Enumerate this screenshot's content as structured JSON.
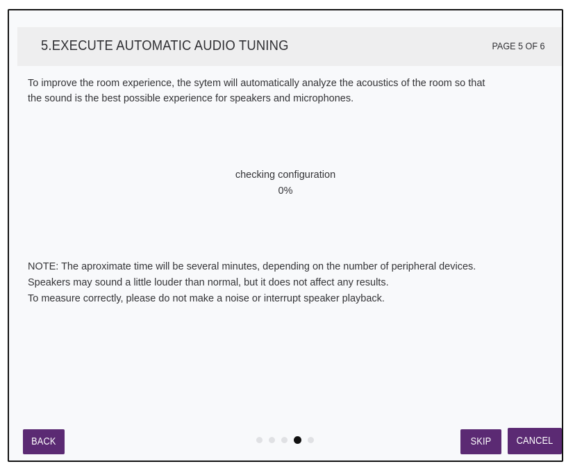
{
  "header": {
    "title": "5.EXECUTE AUTOMATIC AUDIO TUNING",
    "page_indicator": "PAGE 5 OF 6"
  },
  "description": {
    "line1": "To improve the room experience, the sytem will automatically analyze the acoustics of the room so that",
    "line2": "the sound is the best possible experience for speakers and microphones."
  },
  "status": {
    "label": "checking configuration",
    "progress_text": "0%",
    "progress_value": 0
  },
  "note": {
    "line1": "NOTE: The aproximate time will be several minutes, depending on the number of peripheral devices.",
    "line2": "Speakers may sound a little louder than normal, but it does not affect any results.",
    "line3": "To measure correctly, please do not make a noise or interrupt speaker playback."
  },
  "buttons": {
    "back": "BACK",
    "skip": "SKIP",
    "cancel": "CANCEL"
  },
  "pagination": {
    "total": 5,
    "active_index": 3
  },
  "colors": {
    "button": "#5b2a73",
    "active_dot": "#111111",
    "inactive_dot": "#e0e1e4",
    "header_bg": "#eeeeef"
  }
}
